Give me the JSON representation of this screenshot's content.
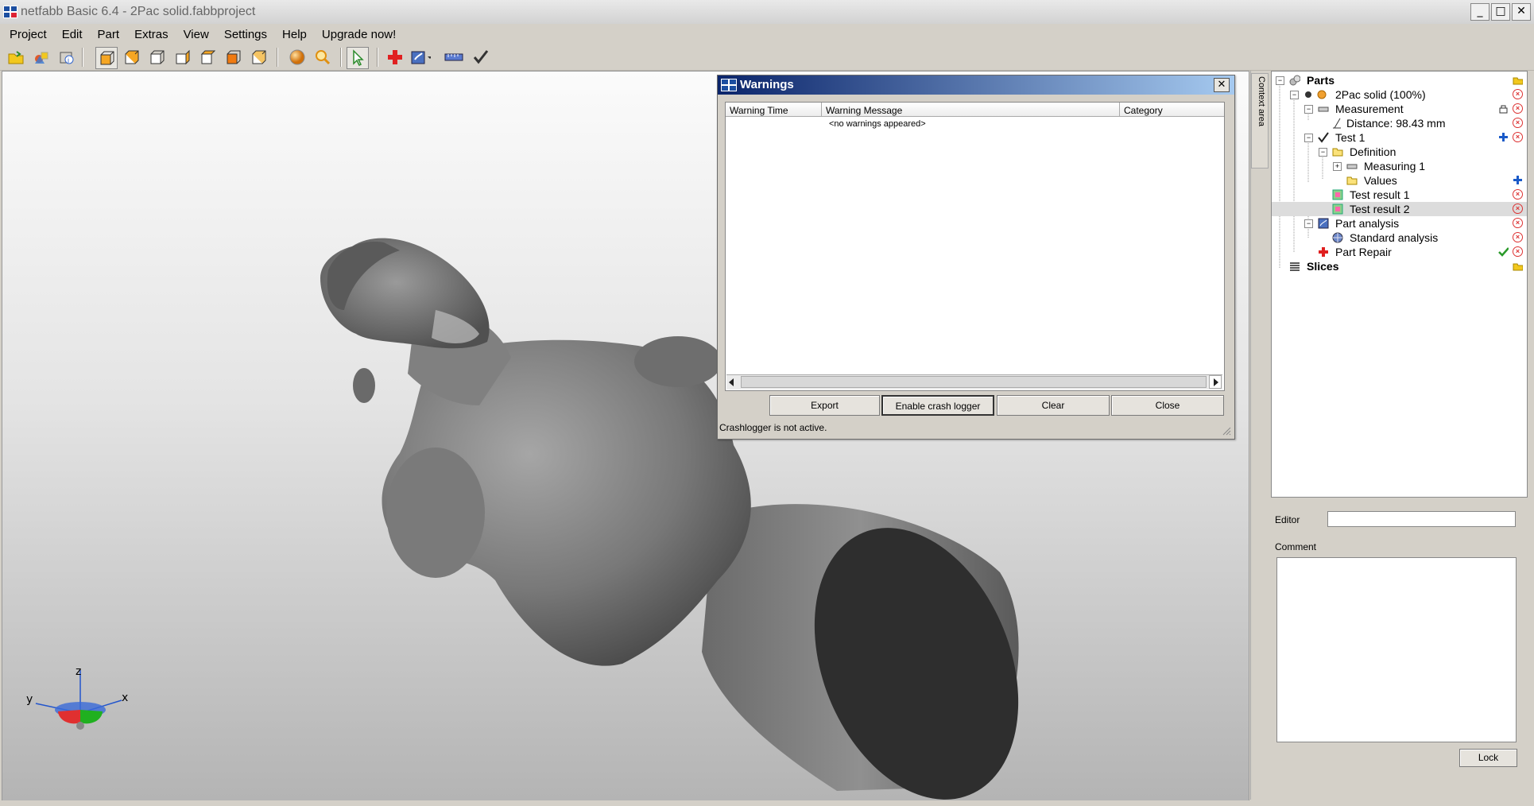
{
  "window": {
    "title": "netfabb Basic 6.4 - 2Pac solid.fabbproject",
    "minimize": "_",
    "maximize": "□",
    "close": "✕"
  },
  "menu": [
    "Project",
    "Edit",
    "Part",
    "Extras",
    "View",
    "Settings",
    "Help",
    "Upgrade now!"
  ],
  "toolbar": {
    "icons": [
      "open-icon",
      "add-part-icon",
      "part-info-icon",
      "view-front-icon",
      "view-back-icon",
      "view-left-icon",
      "view-right-icon",
      "view-top-icon",
      "view-bottom-icon",
      "view-iso-icon",
      "sphere-icon",
      "zoom-icon",
      "select-arrow-icon",
      "repair-cross-icon",
      "analysis-icon",
      "measure-ruler-icon",
      "check-icon"
    ]
  },
  "context_area": {
    "label": "Context area"
  },
  "tree": {
    "rows": [
      {
        "label": "Parts",
        "bold": true
      },
      {
        "label": "2Pac solid (100%)"
      },
      {
        "label": "Measurement"
      },
      {
        "label": "Distance: 98.43 mm"
      },
      {
        "label": "Test 1"
      },
      {
        "label": "Definition"
      },
      {
        "label": "Measuring 1"
      },
      {
        "label": "Values"
      },
      {
        "label": "Test result 1"
      },
      {
        "label": "Test result 2",
        "selected": true
      },
      {
        "label": "Part analysis"
      },
      {
        "label": "Standard analysis"
      },
      {
        "label": "Part Repair"
      },
      {
        "label": "Slices",
        "bold": true
      }
    ]
  },
  "editor": {
    "label": "Editor",
    "value": ""
  },
  "comment": {
    "label": "Comment",
    "value": ""
  },
  "lock_button": "Lock",
  "warnings_dialog": {
    "title": "Warnings",
    "columns": [
      "Warning Time",
      "Warning Message",
      "Category"
    ],
    "empty_message": "<no warnings appeared>",
    "buttons": {
      "export": "Export",
      "crash_logger": "Enable crash logger",
      "clear": "Clear",
      "close": "Close"
    },
    "status": "Crashlogger is not active."
  },
  "axes": {
    "x": "x",
    "y": "y",
    "z": "z"
  }
}
